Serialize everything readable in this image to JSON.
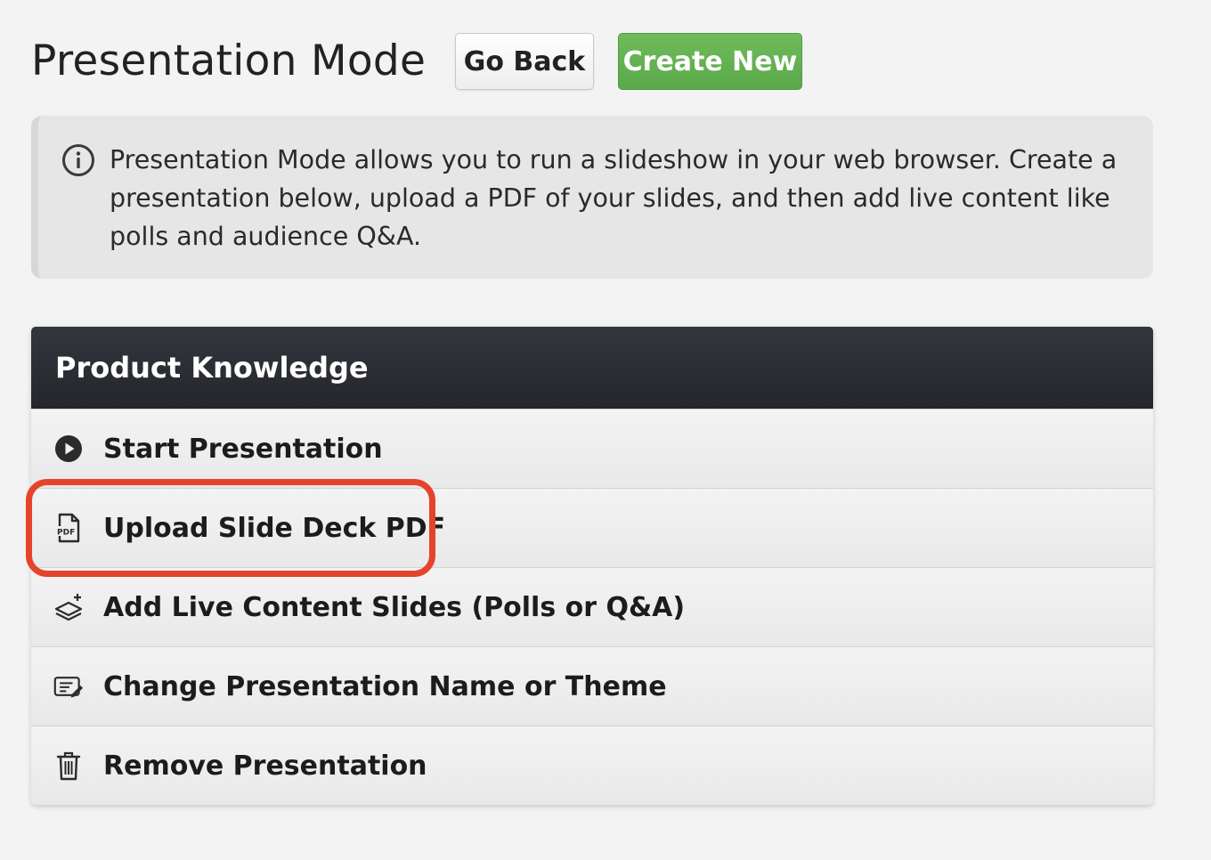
{
  "header": {
    "title": "Presentation Mode",
    "go_back_label": "Go Back",
    "create_new_label": "Create New"
  },
  "info": {
    "icon": "info-icon",
    "text": "Presentation Mode allows you to run a slideshow in your web browser. Create a presentation below, upload a PDF of your slides, and then add live content like polls and audience Q&A."
  },
  "presentation": {
    "name": "Product Knowledge",
    "actions": [
      {
        "label": "Start Presentation",
        "icon": "play-icon"
      },
      {
        "label": "Upload Slide Deck PDF",
        "icon": "pdf-icon"
      },
      {
        "label": "Add Live Content Slides (Polls or Q&A)",
        "icon": "add-slides-icon"
      },
      {
        "label": "Change Presentation Name or Theme",
        "icon": "edit-icon"
      },
      {
        "label": "Remove Presentation",
        "icon": "trash-icon"
      }
    ]
  },
  "colors": {
    "page_background": "#f3f3f3",
    "create_button": "#5fae4e",
    "card_header": "#2a2c31",
    "highlight": "#e5432b"
  }
}
